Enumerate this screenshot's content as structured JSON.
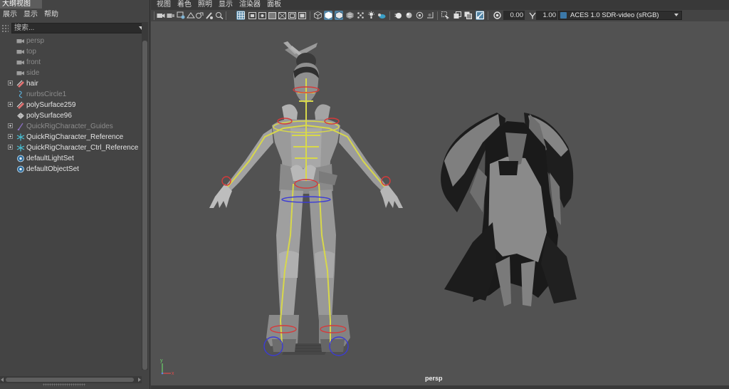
{
  "outliner": {
    "title": "大纲视图",
    "menu": [
      "展示",
      "显示",
      "帮助"
    ],
    "search_placeholder": "搜索...",
    "items": [
      {
        "label": "persp",
        "dim": true,
        "expand": false,
        "icon": "camera-icon"
      },
      {
        "label": "top",
        "dim": true,
        "expand": false,
        "icon": "camera-icon"
      },
      {
        "label": "front",
        "dim": true,
        "expand": false,
        "icon": "camera-icon"
      },
      {
        "label": "side",
        "dim": true,
        "expand": false,
        "icon": "camera-icon"
      },
      {
        "label": "hair",
        "dim": false,
        "expand": true,
        "icon": "mesh-group-icon"
      },
      {
        "label": "nurbsCircle1",
        "dim": true,
        "expand": false,
        "icon": "curve-icon"
      },
      {
        "label": "polySurface259",
        "dim": false,
        "expand": true,
        "icon": "mesh-group-icon"
      },
      {
        "label": "polySurface96",
        "dim": false,
        "expand": false,
        "icon": "mesh-icon"
      },
      {
        "label": "QuickRigCharacter_Guides",
        "dim": true,
        "expand": true,
        "icon": "guides-icon"
      },
      {
        "label": "QuickRigCharacter_Reference",
        "dim": false,
        "expand": true,
        "icon": "joint-icon"
      },
      {
        "label": "QuickRigCharacter_Ctrl_Reference",
        "dim": false,
        "expand": true,
        "icon": "joint-icon"
      },
      {
        "label": "defaultLightSet",
        "dim": false,
        "expand": false,
        "icon": "set-icon"
      },
      {
        "label": "defaultObjectSet",
        "dim": false,
        "expand": false,
        "icon": "set-icon"
      }
    ]
  },
  "viewport_panel": {
    "menu": [
      "视图",
      "着色",
      "照明",
      "显示",
      "渲染器",
      "面板"
    ],
    "exposure_value": "0.00",
    "gamma_value": "1.00",
    "color_management": "ACES 1.0 SDR-video (sRGB)",
    "camera_name": "persp",
    "axis_labels": {
      "x": "x",
      "y": "y"
    }
  },
  "colors": {
    "accent": "#5285a6",
    "joint_yellow": "#d8d84a",
    "control_red": "#d63a3a",
    "control_blue": "#3b3bd6"
  }
}
